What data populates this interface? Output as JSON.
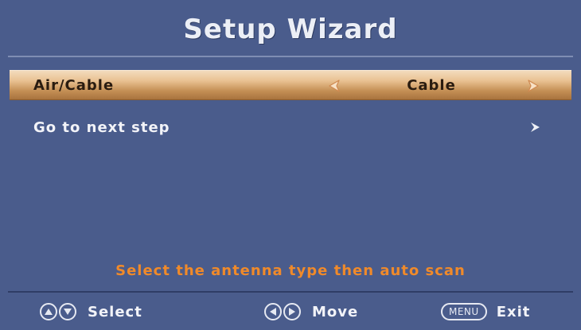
{
  "title": "Setup Wizard",
  "menu": {
    "items": [
      {
        "label": "Air/Cable",
        "value": "Cable",
        "selected": true
      },
      {
        "label": "Go to next step",
        "selected": false
      }
    ]
  },
  "hint": "Select the antenna type then auto scan",
  "footer": {
    "select_label": "Select",
    "move_label": "Move",
    "menu_key": "MENU",
    "exit_label": "Exit"
  },
  "colors": {
    "background": "#4a5c8c",
    "highlight": "#e9c192",
    "hint_text": "#f08a2a"
  },
  "icons": {
    "value_left": "triangle-left-icon",
    "value_right": "triangle-right-icon",
    "next": "chevron-right-icon",
    "up": "up-button-icon",
    "down": "down-button-icon",
    "left": "left-button-icon",
    "right": "right-button-icon"
  }
}
